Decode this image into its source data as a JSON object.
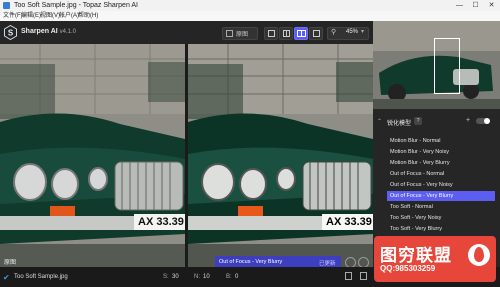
{
  "window": {
    "title": "Too Soft Sample.jpg - Topaz Sharpen AI",
    "min": "—",
    "max": "☐",
    "close": "✕"
  },
  "menu": [
    "文件(F)",
    "编辑(E)",
    "视图(V)",
    "帐户(A)",
    "帮助(H)"
  ],
  "app": {
    "name": "Sharpen AI",
    "version": "v4.1.0"
  },
  "toolbar": {
    "compare_label": "原图",
    "zoom_label": "45%"
  },
  "viewer": {
    "left_label": "原图",
    "plate": "AX 33.39"
  },
  "ai_model": {
    "header": "锐化模型",
    "help": "?",
    "plus": "+",
    "items": [
      "Motion Blur - Normal",
      "Motion Blur - Very Noisy",
      "Motion Blur - Very Blurry",
      "Out of Focus - Normal",
      "Out of Focus - Very Noisy",
      "Out of Focus - Very Blurry",
      "Too Soft - Normal",
      "Too Soft - Very Noisy",
      "Too Soft - Very Blurry"
    ],
    "selected_index": 5
  },
  "overlay": {
    "label": "Out of Focus - Very Blurry",
    "action": "已更新"
  },
  "status": {
    "filename": "Too Soft Sample.jpg",
    "s_label": "S:",
    "s_value": "30",
    "n_label": "N:",
    "n_value": "10",
    "b_label": "B:",
    "b_value": "0"
  },
  "promo": {
    "title": "图穷联盟",
    "qq": "QQ:985303259"
  },
  "colors": {
    "accent": "#5b5ef0",
    "car_green": "#0e3a2c",
    "promo_red": "#e7473b"
  }
}
